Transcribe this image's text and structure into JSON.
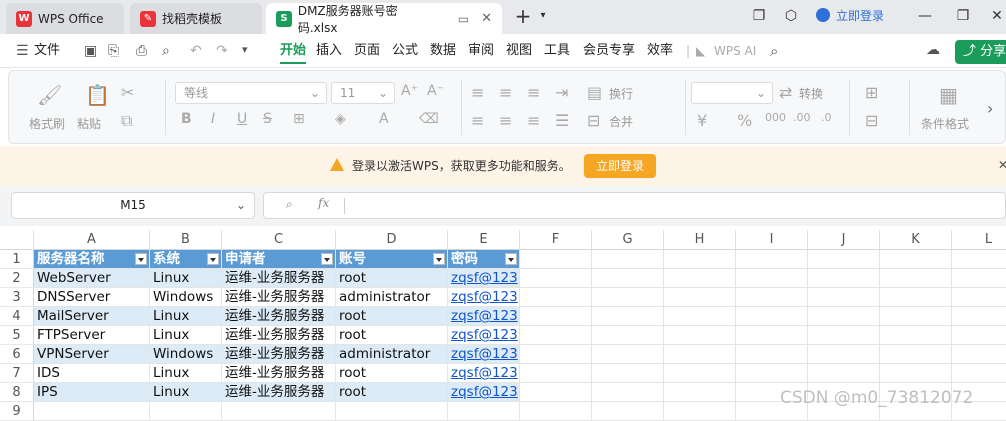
{
  "tabs": [
    {
      "label": "WPS Office",
      "logo_color": "#e8343a"
    },
    {
      "label": "找稻壳模板",
      "logo_color": "#e8343a"
    },
    {
      "label": "DMZ服务器账号密码.xlsx",
      "logo_color": "#1a9c5b"
    }
  ],
  "titlebar": {
    "login": "立即登录"
  },
  "menu": {
    "file": "文件",
    "items": [
      "开始",
      "插入",
      "页面",
      "公式",
      "数据",
      "审阅",
      "视图",
      "工具",
      "会员专享",
      "效率"
    ],
    "wpsai": "WPS AI",
    "share": "分享"
  },
  "ribbon": {
    "format_painter": "格式刷",
    "paste": "粘贴",
    "font_name": "等线",
    "font_size": "11",
    "wrap": "换行",
    "convert": "转换",
    "merge": "合并",
    "cond_format": "条件格式"
  },
  "banner": {
    "message": "登录以激活WPS，获取更多功能和服务。",
    "button": "立即登录"
  },
  "formula": {
    "cell_ref": "M15",
    "fx": "fx"
  },
  "sheet": {
    "columns": [
      "A",
      "B",
      "C",
      "D",
      "E",
      "F",
      "G",
      "H",
      "I",
      "J",
      "K",
      "L"
    ],
    "rows": [
      "1",
      "2",
      "3",
      "4",
      "5",
      "6",
      "7",
      "8",
      "9"
    ],
    "header": [
      "服务器名称",
      "系统",
      "申请者",
      "账号",
      "密码"
    ],
    "data": [
      [
        "WebServer",
        "Linux",
        "运维-业务服务器",
        "root",
        "zqsf@123"
      ],
      [
        "DNSServer",
        "Windows",
        "运维-业务服务器",
        "administrator",
        "zqsf@123"
      ],
      [
        "MailServer",
        "Linux",
        "运维-业务服务器",
        "root",
        "zqsf@123"
      ],
      [
        "FTPServer",
        "Linux",
        "运维-业务服务器",
        "root",
        "zqsf@123"
      ],
      [
        "VPNServer",
        "Windows",
        "运维-业务服务器",
        "administrator",
        "zqsf@123"
      ],
      [
        "IDS",
        "Linux",
        "运维-业务服务器",
        "root",
        "zqsf@123"
      ],
      [
        "IPS",
        "Linux",
        "运维-业务服务器",
        "root",
        "zqsf@123"
      ]
    ]
  },
  "watermark": "CSDN @m0_73812072"
}
